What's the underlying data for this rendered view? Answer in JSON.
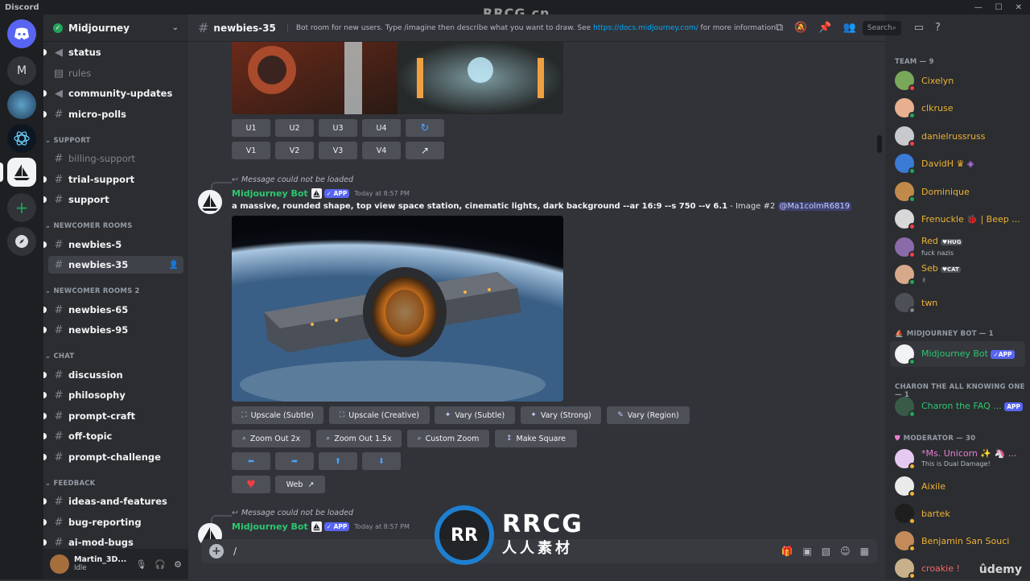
{
  "window": {
    "app_name": "Discord"
  },
  "watermark": {
    "top": "RRCG.cn",
    "logo_text": "RRCG",
    "logo_sub": "人人素材",
    "logo_ring": "RR"
  },
  "servers": [
    {
      "name": "home",
      "glyph": "◕"
    },
    {
      "name": "M",
      "glyph": "M"
    },
    {
      "name": "server-3",
      "glyph": ""
    },
    {
      "name": "server-quantum",
      "glyph": ""
    },
    {
      "name": "midjourney",
      "glyph": "⛵"
    },
    {
      "name": "add-server",
      "glyph": "+"
    },
    {
      "name": "explore",
      "glyph": "⦿"
    }
  ],
  "guild": {
    "name": "Midjourney"
  },
  "channels": {
    "top": [
      {
        "name": "status",
        "icon": "📢"
      },
      {
        "name": "rules",
        "icon": "▤"
      },
      {
        "name": "community-updates",
        "icon": "📢"
      },
      {
        "name": "micro-polls",
        "icon": "#"
      }
    ],
    "support_cat": "SUPPORT",
    "support": [
      "billing-support",
      "trial-support",
      "support"
    ],
    "newcomer_cat": "NEWCOMER ROOMS",
    "newcomer": [
      "newbies-5",
      "newbies-35"
    ],
    "newcomer2_cat": "NEWCOMER ROOMS 2",
    "newcomer2": [
      "newbies-65",
      "newbies-95"
    ],
    "chat_cat": "CHAT",
    "chat": [
      "discussion",
      "philosophy",
      "prompt-craft",
      "off-topic",
      "prompt-challenge"
    ],
    "feedback_cat": "FEEDBACK",
    "feedback": [
      "ideas-and-features",
      "bug-reporting",
      "ai-mod-bugs"
    ]
  },
  "user": {
    "name": "Martin_3D...",
    "status": "Idle"
  },
  "topbar": {
    "channel": "newbies-35",
    "topic_pre": "Bot room for new users. Type /imagine then describe what you want to draw. See ",
    "topic_link": "https://docs.midjourney.com/",
    "topic_post": " for more information",
    "search_placeholder": "Search"
  },
  "grid_buttons": {
    "row1": [
      "U1",
      "U2",
      "U3",
      "U4",
      "↻"
    ],
    "row2": [
      "V1",
      "V2",
      "V3",
      "V4",
      "↗"
    ]
  },
  "message1": {
    "reply": "Message could not be loaded",
    "author": "Midjourney Bot",
    "app": "APP",
    "time": "Today at 8:57 PM",
    "prompt": "a massive, rounded shape, top view space station, cinematic lights, dark background --ar 16:9 --s 750 --v 6.1",
    "suffix": " - Image #2 ",
    "mention": "@Ma1colmR6819"
  },
  "actions": {
    "row1": [
      "Upscale (Subtle)",
      "Upscale (Creative)",
      "Vary (Subtle)",
      "Vary (Strong)",
      "Vary (Region)"
    ],
    "row2": [
      "Zoom Out 2x",
      "Zoom Out 1.5x",
      "Custom Zoom",
      "Make Square"
    ],
    "arrows": [
      "⬅",
      "➡",
      "⬆",
      "⬇"
    ],
    "heart": "♥",
    "web": "Web"
  },
  "message2": {
    "reply": "Message could not be loaded",
    "author": "Midjourney Bot",
    "app": "APP",
    "time": "Today at 8:57 PM"
  },
  "composer": {
    "value": "/"
  },
  "members": {
    "team_cat": "TEAM — 9",
    "team": [
      {
        "name": "Cixelyn",
        "color": "#f0b232",
        "av": "#7aa85a",
        "status": "#f23f43"
      },
      {
        "name": "clkruse",
        "color": "#f0b232",
        "av": "#e8b090",
        "status": "#23a55a"
      },
      {
        "name": "danielrussruss",
        "color": "#f0b232",
        "av": "#c7c9cc",
        "status": "#f23f43"
      },
      {
        "name": "DavidH",
        "color": "#f0b232",
        "av": "#3b7bd6",
        "status": "#23a55a"
      },
      {
        "name": "Dominique",
        "color": "#f0b232",
        "av": "#c28a4a",
        "status": "#23a55a"
      },
      {
        "name": "Frenuckle",
        "color": "#f0b232",
        "av": "#d8d8d8",
        "status": "#f23f43",
        "extra": " 🐞 | Beep ..."
      },
      {
        "name": "Red",
        "color": "#f0b232",
        "av": "#8a6aa8",
        "status": "#f23f43",
        "tag": "HUG",
        "sub": "fuck nazis"
      },
      {
        "name": "Seb",
        "color": "#f0b232",
        "av": "#d8a88a",
        "status": "#23a55a",
        "tag": "CAT",
        "sub": "✌"
      },
      {
        "name": "twn",
        "color": "#f0b232",
        "av": "#4e5058",
        "status": "#80848e"
      }
    ],
    "bot_cat": "MIDJOURNEY BOT — 1",
    "bot": {
      "name": "Midjourney Bot",
      "app": "APP",
      "color": "#2dc770"
    },
    "charon_cat": "CHARON THE ALL KNOWING ONE — 1",
    "charon": {
      "name": "Charon the FAQ ...",
      "app": "APP",
      "color": "#2dc770"
    },
    "mod_cat": "MODERATOR — 30",
    "mods": [
      {
        "name": "*Ms. Unicorn ✨ 🦄 ...",
        "color": "#e97fd0",
        "av": "#e6c9f0",
        "status": "#f0b232",
        "sub": "This is Dual Damage!"
      },
      {
        "name": "Aixile",
        "color": "#f0b232",
        "av": "#eaeaea",
        "status": "#f0b232"
      },
      {
        "name": "bartek",
        "color": "#f0b232",
        "av": "#1e1e1e",
        "status": "#f0b232"
      },
      {
        "name": "Benjamin San Souci",
        "color": "#f0b232",
        "av": "#c38a5a",
        "status": "#f0b232"
      },
      {
        "name": "croakie !",
        "color": "#f06a6a",
        "av": "#c8b08a",
        "status": "#f0b232"
      }
    ]
  },
  "brand": {
    "udemy": "ûdemy",
    "accent": "#5865f2",
    "online": "#23a55a",
    "bot_green": "#2dc770"
  }
}
